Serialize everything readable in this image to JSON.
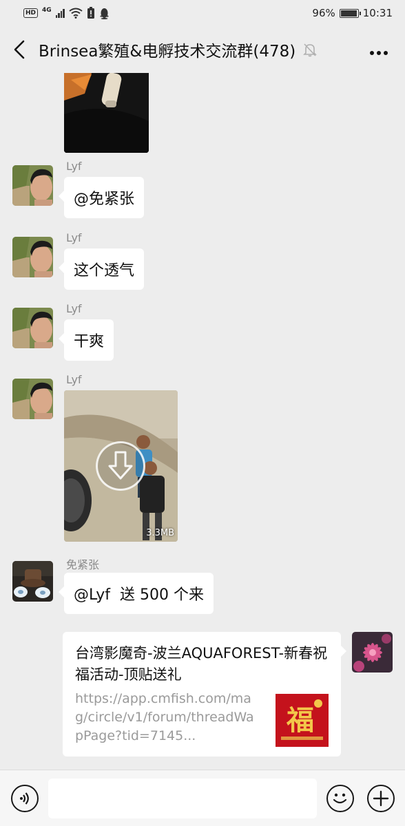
{
  "status_bar": {
    "network_badge": "HD",
    "network_type": "4G",
    "battery_percent": "96%",
    "battery_level": 0.96,
    "time": "10:31"
  },
  "header": {
    "back_icon": "back-chevron-icon",
    "title": "Brinsea繁殖&电孵技术交流群(478)",
    "mute_icon": "mute-bell-icon",
    "more_icon": "more-dots-icon"
  },
  "messages": [
    {
      "type": "video",
      "sender": "",
      "partial": true
    },
    {
      "type": "text",
      "sender": "Lyf",
      "text": "@免紧张"
    },
    {
      "type": "text",
      "sender": "Lyf",
      "text": "这个透气"
    },
    {
      "type": "text",
      "sender": "Lyf",
      "text": "干爽"
    },
    {
      "type": "video",
      "sender": "Lyf",
      "size": "3.3MB",
      "icon": "download-icon"
    },
    {
      "type": "text",
      "sender": "免紧张",
      "text": "@Lyf  送 500 个来"
    },
    {
      "type": "link",
      "sender": "self",
      "title": "台湾影魔奇-波兰AQUAFOREST-新春祝福活动-顶贴送礼",
      "url": "https://app.cmfish.com/mag/circle/v1/forum/threadWapPage?tid=7145...",
      "thumb_text": "福"
    }
  ],
  "input_bar": {
    "voice_icon": "voice-icon",
    "input_value": "",
    "emoji_icon": "emoji-icon",
    "plus_icon": "plus-icon"
  },
  "colors": {
    "background": "#ededed",
    "bubble": "#ffffff",
    "sender_name": "#8a8a8a",
    "url_text": "#9a9a9a",
    "thumb_red": "#c4121c",
    "thumb_gold": "#f3c74a"
  }
}
